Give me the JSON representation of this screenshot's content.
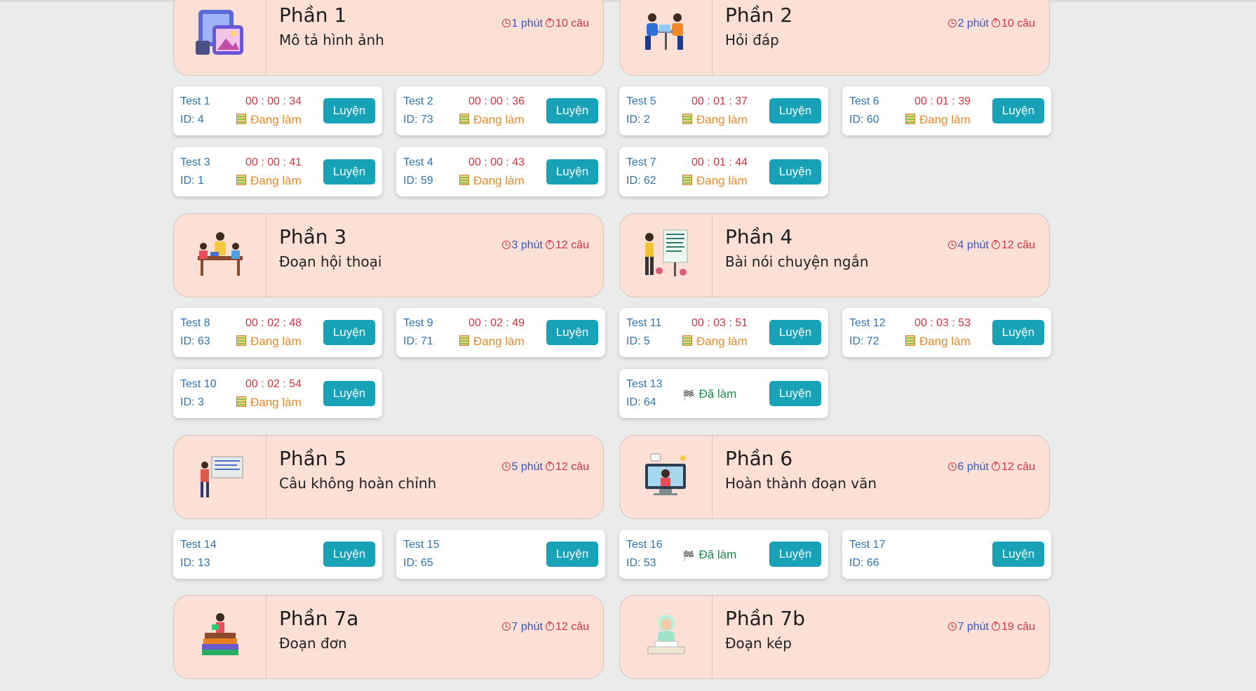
{
  "colors": {
    "card_bg": "#fde0d5",
    "button": "#17a2b8",
    "time": "#3457c4",
    "questions": "#d03543",
    "in_progress": "#e8892b",
    "done": "#1e8a47"
  },
  "parts": [
    {
      "title": "Phần 1",
      "subtitle": "Mô tả hình ảnh",
      "time": "1 phút",
      "questions": "10 câu",
      "image": "picture-gallery-icon",
      "tests": [
        {
          "name": "Test 1",
          "id": "ID: 4",
          "timer": "00 : 00 : 34",
          "status": "Đang làm",
          "action": "Luyện"
        },
        {
          "name": "Test 2",
          "id": "ID: 73",
          "timer": "00 : 00 : 36",
          "status": "Đang làm",
          "action": "Luyện"
        },
        {
          "name": "Test 3",
          "id": "ID: 1",
          "timer": "00 : 00 : 41",
          "status": "Đang làm",
          "action": "Luyện"
        },
        {
          "name": "Test 4",
          "id": "ID: 59",
          "timer": "00 : 00 : 43",
          "status": "Đang làm",
          "action": "Luyện"
        }
      ]
    },
    {
      "title": "Phần 2",
      "subtitle": "Hỏi đáp",
      "time": "2 phút",
      "questions": "10 câu",
      "image": "people-talking-icon",
      "tests": [
        {
          "name": "Test 5",
          "id": "ID: 2",
          "timer": "00 : 01 : 37",
          "status": "Đang làm",
          "action": "Luyện"
        },
        {
          "name": "Test 6",
          "id": "ID: 60",
          "timer": "00 : 01 : 39",
          "status": "Đang làm",
          "action": "Luyện"
        },
        {
          "name": "Test 7",
          "id": "ID: 62",
          "timer": "00 : 01 : 44",
          "status": "Đang làm",
          "action": "Luyện"
        }
      ]
    },
    {
      "title": "Phần 3",
      "subtitle": "Đoạn hội thoại",
      "time": "3 phút",
      "questions": "12 câu",
      "image": "meeting-icon",
      "tests": [
        {
          "name": "Test 8",
          "id": "ID: 63",
          "timer": "00 : 02 : 48",
          "status": "Đang làm",
          "action": "Luyện"
        },
        {
          "name": "Test 9",
          "id": "ID: 71",
          "timer": "00 : 02 : 49",
          "status": "Đang làm",
          "action": "Luyện"
        },
        {
          "name": "Test 10",
          "id": "ID: 3",
          "timer": "00 : 02 : 54",
          "status": "Đang làm",
          "action": "Luyện"
        }
      ]
    },
    {
      "title": "Phần 4",
      "subtitle": "Bài nói chuyện ngắn",
      "time": "4 phút",
      "questions": "12 câu",
      "image": "presentation-icon",
      "tests": [
        {
          "name": "Test 11",
          "id": "ID: 5",
          "timer": "00 : 03 : 51",
          "status": "Đang làm",
          "action": "Luyện"
        },
        {
          "name": "Test 12",
          "id": "ID: 72",
          "timer": "00 : 03 : 53",
          "status": "Đang làm",
          "action": "Luyện"
        },
        {
          "name": "Test 13",
          "id": "ID: 64",
          "timer": "",
          "status": "Đã làm",
          "action": "Luyện"
        }
      ]
    },
    {
      "title": "Phần 5",
      "subtitle": "Câu không hoàn chỉnh",
      "time": "5 phút",
      "questions": "12 câu",
      "image": "teacher-board-icon",
      "tests": [
        {
          "name": "Test 14",
          "id": "ID: 13",
          "timer": "",
          "status": "",
          "action": "Luyện"
        },
        {
          "name": "Test 15",
          "id": "ID: 65",
          "timer": "",
          "status": "",
          "action": "Luyện"
        }
      ]
    },
    {
      "title": "Phần 6",
      "subtitle": "Hoàn thành đoạn văn",
      "time": "6 phút",
      "questions": "12 câu",
      "image": "online-class-icon",
      "tests": [
        {
          "name": "Test 16",
          "id": "ID: 53",
          "timer": "",
          "status": "Đã làm",
          "action": "Luyện"
        },
        {
          "name": "Test 17",
          "id": "ID: 66",
          "timer": "",
          "status": "",
          "action": "Luyện"
        }
      ]
    },
    {
      "title": "Phần 7a",
      "subtitle": "Đoạn đơn",
      "time": "7 phút",
      "questions": "12 câu",
      "image": "books-reading-icon",
      "tests": []
    },
    {
      "title": "Phần 7b",
      "subtitle": "Đoạn kép",
      "time": "7 phút",
      "questions": "19 câu",
      "image": "student-reading-icon",
      "tests": []
    }
  ]
}
